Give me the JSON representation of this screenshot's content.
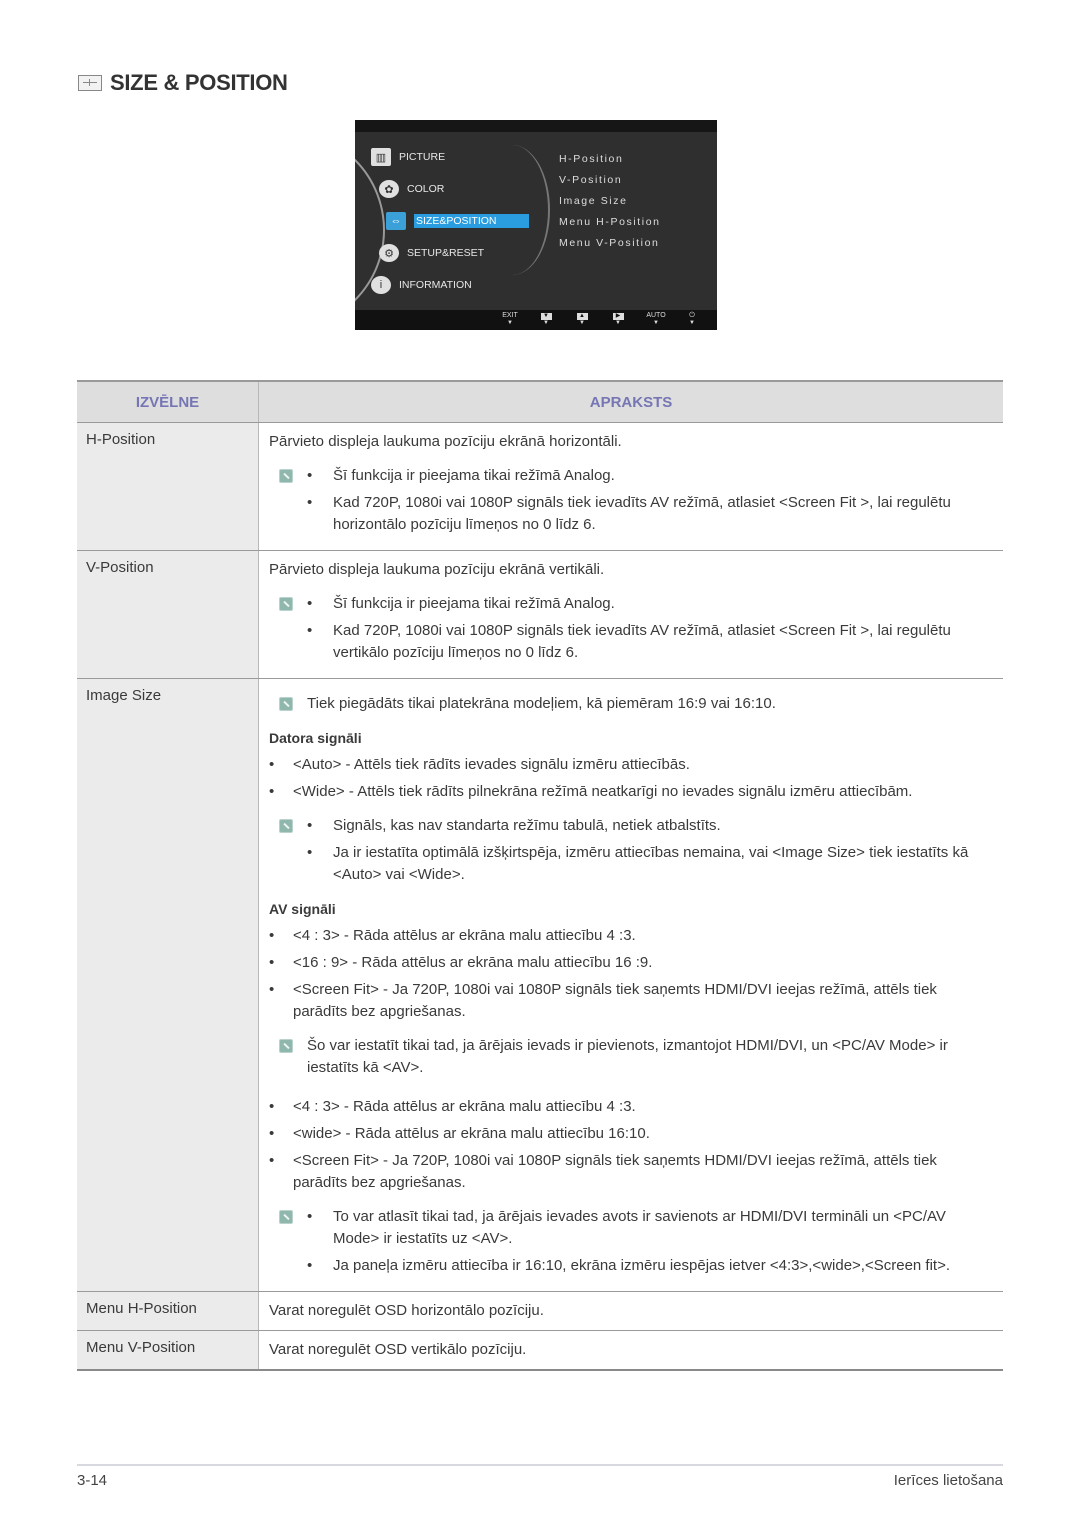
{
  "page": {
    "title": "SIZE & POSITION",
    "title_icon": "size-position-icon"
  },
  "osd": {
    "menu": [
      {
        "label": "PICTURE",
        "icon": "picture-icon",
        "glyph": "▥"
      },
      {
        "label": "COLOR",
        "icon": "palette-icon",
        "glyph": "✿"
      },
      {
        "label": "SIZE&POSITION",
        "icon": "size-position-icon",
        "glyph": "⇔",
        "selected": true
      },
      {
        "label": "SETUP&RESET",
        "icon": "gear-icon",
        "glyph": "⚙"
      },
      {
        "label": "INFORMATION",
        "icon": "info-icon",
        "glyph": "i"
      }
    ],
    "submenu": [
      "H-Position",
      "V-Position",
      "Image Size",
      "Menu H-Position",
      "Menu V-Position"
    ],
    "buttons": [
      {
        "label": "EXIT",
        "icon": "exit-icon",
        "glyph": "EXIT"
      },
      {
        "label": "down",
        "icon": "down-arrow-icon",
        "glyph": "▼"
      },
      {
        "label": "up",
        "icon": "up-arrow-icon",
        "glyph": "▲"
      },
      {
        "label": "right",
        "icon": "right-arrow-icon",
        "glyph": "▶"
      },
      {
        "label": "AUTO",
        "icon": "auto-icon",
        "glyph": "AUTO"
      },
      {
        "label": "power",
        "icon": "power-icon",
        "glyph": "⏻"
      }
    ],
    "button_marker": "▼",
    "selected_color": "#2a9ce0"
  },
  "table": {
    "headers": [
      "IZVĒLNE",
      "APRAKSTS"
    ],
    "header_color": "#7676b4",
    "rows": {
      "hpos": {
        "menu": "H-Position",
        "intro": "Pārvieto displeja laukuma pozīciju ekrānā horizontāli.",
        "notes": [
          "Šī funkcija ir pieejama tikai režīmā Analog.",
          "Kad 720P, 1080i vai 1080P signāls tiek ievadīts AV režīmā, atlasiet <Screen Fit  >, lai regulētu horizontālo pozīciju līmeņos no 0 līdz 6."
        ]
      },
      "vpos": {
        "menu": "V-Position",
        "intro": "Pārvieto displeja laukuma pozīciju ekrānā vertikāli.",
        "notes": [
          "Šī funkcija ir pieejama tikai režīmā Analog.",
          "Kad 720P, 1080i vai 1080P signāls tiek ievadīts AV režīmā, atlasiet <Screen Fit  >, lai regulētu vertikālo pozīciju līmeņos no 0 līdz 6."
        ]
      },
      "imgsize": {
        "menu": "Image Size",
        "note_top": "Tiek piegādāts tikai platekrāna modeļiem, kā piemēram 16:9 vai 16:10.",
        "pc_heading": "Datora signāli",
        "pc_items": [
          "<Auto> - Attēls tiek rādīts ievades signālu izmēru attiecībās.",
          "<Wide> - Attēls tiek rādīts pilnekrāna režīmā neatkarīgi no ievades signālu izmēru attiecībām."
        ],
        "pc_notes": [
          "Signāls, kas nav standarta režīmu tabulā, netiek atbalstīts.",
          "Ja ir iestatīta optimālā izšķirtspēja, izmēru attiecības nemaina, vai <Image Size> tiek iestatīts kā <Auto> vai <Wide>."
        ],
        "av_heading": "AV signāli",
        "av_items_1": [
          "<4 : 3> - Rāda attēlus ar ekrāna malu attiecību 4 :3.",
          "<16 : 9> - Rāda attēlus ar ekrāna malu attiecību 16 :9.",
          "<Screen Fit> - Ja 720P, 1080i vai 1080P signāls tiek saņemts HDMI/DVI ieejas režīmā, attēls tiek parādīts bez apgriešanas."
        ],
        "av_note": "Šo var iestatīt tikai tad, ja ārējais ievads ir pievienots, izmantojot HDMI/DVI, un <PC/AV Mode> ir iestatīts kā <AV>.",
        "av_items_2": [
          "<4 : 3> - Rāda attēlus ar ekrāna malu attiecību 4 :3.",
          "<wide> - Rāda attēlus ar ekrāna malu attiecību 16:10.",
          "<Screen Fit> - Ja 720P, 1080i vai 1080P signāls tiek saņemts HDMI/DVI ieejas režīmā, attēls tiek parādīts bez apgriešanas."
        ],
        "av_notes_2": [
          "To var atlasīt tikai tad, ja ārējais ievades avots ir savienots ar HDMI/DVI termināli un <PC/AV Mode> ir iestatīts uz <AV>.",
          "Ja paneļa izmēru attiecība ir 16:10, ekrāna izmēru iespējas ietver <4:3>,<wide>,<Screen fit>."
        ]
      },
      "menuh": {
        "menu": "Menu H-Position",
        "intro": "Varat noregulēt OSD horizontālo pozīciju."
      },
      "menuv": {
        "menu": "Menu V-Position",
        "intro": "Varat noregulēt OSD vertikālo pozīciju."
      }
    }
  },
  "bullet": "•",
  "footer": {
    "page_number": "3-14",
    "section": "Ierīces lietošana"
  }
}
